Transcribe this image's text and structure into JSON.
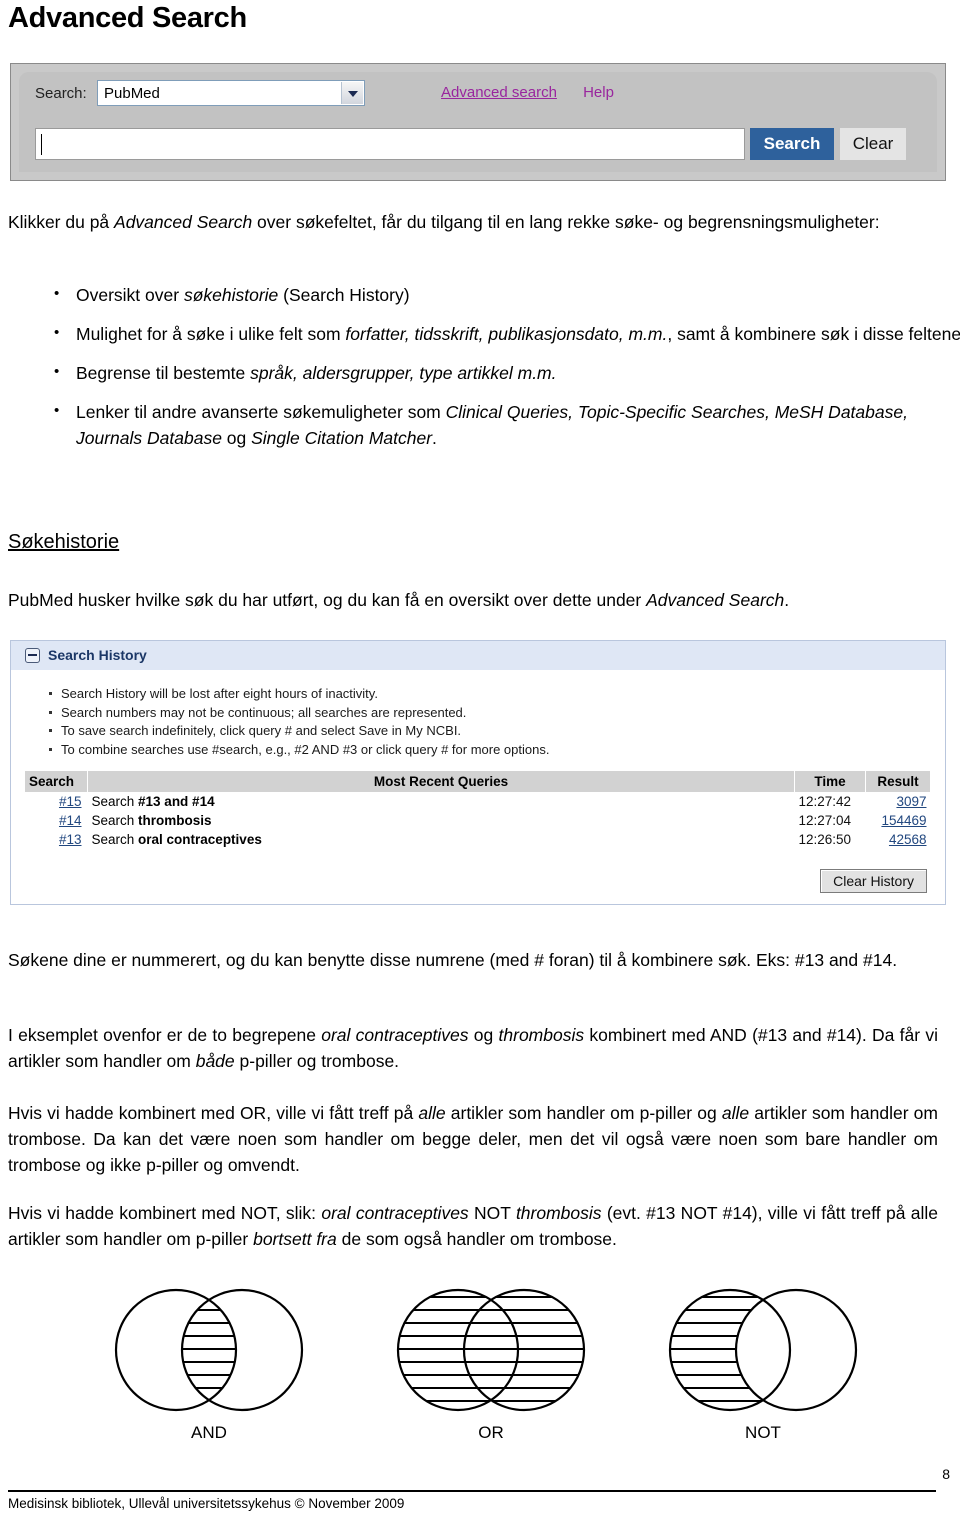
{
  "page_title": "Advanced Search",
  "pubmed_bar": {
    "database_label": "Search:",
    "database_value": "PubMed",
    "links": [
      {
        "label": "Advanced search",
        "underlined": true
      },
      {
        "label": "Help",
        "underlined": false
      }
    ],
    "query_value": "",
    "search_button": "Search",
    "clear_button": "Clear",
    "accent_blue": "#2e619c",
    "link_purple": "#99269e"
  },
  "intro": {
    "before": "Klikker du på ",
    "italic": "Advanced Search",
    "after": " over søkefeltet, får du tilgang til en lang rekke søke- og begrensningsmuligheter:"
  },
  "bullets": [
    {
      "parts": [
        {
          "text": "Oversikt over ",
          "italic": false
        },
        {
          "text": "søkehistorie",
          "italic": true
        },
        {
          "text": " (Search History)",
          "italic": false
        }
      ]
    },
    {
      "parts": [
        {
          "text": "Mulighet for å søke i ulike felt som ",
          "italic": false
        },
        {
          "text": "forfatter, tidsskrift, publikasjonsdato, m.m.",
          "italic": true
        },
        {
          "text": ", samt å kombinere søk i disse feltene.",
          "italic": false
        }
      ]
    },
    {
      "parts": [
        {
          "text": "Begrense til bestemte ",
          "italic": false
        },
        {
          "text": "språk, aldersgrupper, type artikkel m.m.",
          "italic": true
        }
      ]
    },
    {
      "parts": [
        {
          "text": "Lenker til andre avanserte søkemuligheter som ",
          "italic": false
        },
        {
          "text": "Clinical Queries, Topic-Specific Searches, MeSH Database, Journals Database",
          "italic": true
        },
        {
          "text": " og ",
          "italic": false
        },
        {
          "text": "Single Citation Matcher",
          "italic": true
        },
        {
          "text": ".",
          "italic": false
        }
      ]
    }
  ],
  "heading_sokehistorie": "Søkehistorie",
  "p_sokehistorie": {
    "before": "PubMed husker hvilke søk du har utført, og du kan få en oversikt over dette under ",
    "italic": "Advanced Search",
    "after": "."
  },
  "search_history": {
    "panel_title": "Search History",
    "collapse_icon": "minus-icon",
    "notes": [
      "Search History will be lost after eight hours of inactivity.",
      "Search numbers may not be continuous; all searches are represented.",
      "To save search indefinitely, click query # and select Save in My NCBI.",
      "To combine searches use #search, e.g., #2 AND #3 or click query # for more options."
    ],
    "columns": [
      "Search",
      "Most Recent Queries",
      "Time",
      "Result"
    ],
    "rows": [
      {
        "search": "#15",
        "query_prefix": "Search ",
        "query": "#13 and #14",
        "time": "12:27:42",
        "result": "3097"
      },
      {
        "search": "#14",
        "query_prefix": "Search ",
        "query": "thrombosis",
        "time": "12:27:04",
        "result": "154469"
      },
      {
        "search": "#13",
        "query_prefix": "Search ",
        "query": "oral contraceptives",
        "time": "12:26:50",
        "result": "42568"
      }
    ],
    "clear_history_button": "Clear History",
    "header_bg": "#dfe7f5",
    "title_color": "#1b3766",
    "link_color": "#21477f"
  },
  "paragraphs": {
    "p1": {
      "text": "Søkene dine er nummerert, og du kan benytte disse numrene (med # foran) til å kombinere søk. Eks: #13 and #14."
    },
    "p2": {
      "parts": [
        {
          "text": "I eksemplet ovenfor er de to begrepene ",
          "italic": false
        },
        {
          "text": "oral contraceptives",
          "italic": true
        },
        {
          "text": " og ",
          "italic": false
        },
        {
          "text": "thrombosis",
          "italic": true
        },
        {
          "text": " kombinert med AND (#13 and #14). Da får vi artikler som handler om ",
          "italic": false
        },
        {
          "text": "både",
          "italic": true
        },
        {
          "text": " p-piller og trombose.",
          "italic": false
        }
      ]
    },
    "p3": {
      "parts": [
        {
          "text": "Hvis vi hadde kombinert med OR, ville vi fått treff på ",
          "italic": false
        },
        {
          "text": "alle",
          "italic": true
        },
        {
          "text": " artikler som handler om p-piller og ",
          "italic": false
        },
        {
          "text": "alle",
          "italic": true
        },
        {
          "text": " artikler som handler om trombose. Da kan det være noen som handler om begge deler, men det vil også være noen som bare handler om trombose og ikke p-piller og omvendt.",
          "italic": false
        }
      ]
    },
    "p4": {
      "parts": [
        {
          "text": "Hvis vi hadde kombinert med NOT, slik: ",
          "italic": false
        },
        {
          "text": "oral contraceptives",
          "italic": true
        },
        {
          "text": " NOT ",
          "italic": false
        },
        {
          "text": "thrombosis",
          "italic": true
        },
        {
          "text": " (evt. #13 NOT #14), ville vi fått treff på alle artikler som handler om p-piller ",
          "italic": false
        },
        {
          "text": "bortsett fra",
          "italic": true
        },
        {
          "text": " de som også handler om trombose.",
          "italic": false
        }
      ]
    }
  },
  "venn": [
    {
      "label": "AND",
      "shaded": "intersection"
    },
    {
      "label": "OR",
      "shaded": "union"
    },
    {
      "label": "NOT",
      "shaded": "left-minus-right"
    }
  ],
  "footer": {
    "page_number": "8",
    "text": "Medisinsk bibliotek, Ullevål universitetssykehus  ©    November 2009"
  }
}
